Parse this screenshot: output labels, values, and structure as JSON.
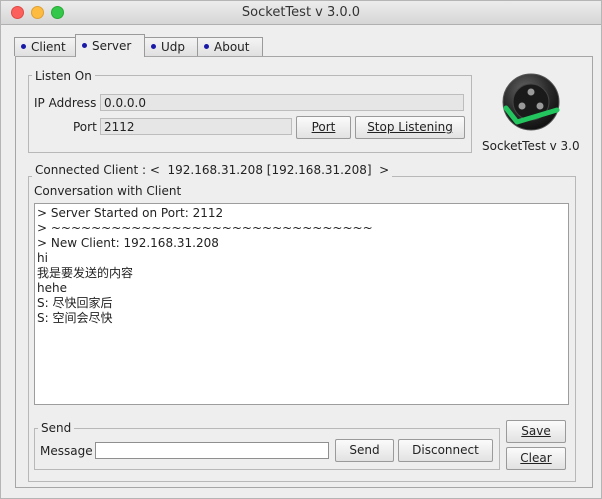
{
  "window": {
    "title": "SocketTest v 3.0.0"
  },
  "tabs": [
    {
      "label": "Client"
    },
    {
      "label": "Server",
      "active": true
    },
    {
      "label": "Udp"
    },
    {
      "label": "About"
    }
  ],
  "listen": {
    "group_label": "Listen On",
    "ip_label": "IP Address",
    "ip_value": "0.0.0.0",
    "port_label": "Port",
    "port_value": "2112",
    "port_button_label": "Port",
    "stop_button_label": "Stop Listening"
  },
  "logo": {
    "caption": "SocketTest v 3.0",
    "icon": "socket-logo-icon",
    "check_color": "#22c55e"
  },
  "connected": {
    "label": "Connected Client : <  192.168.31.208 [192.168.31.208]  >",
    "conversation_label": "Conversation with Client",
    "lines": [
      "> Server Started on Port: 2112",
      "> ~~~~~~~~~~~~~~~~~~~~~~~~~~~~~~~~",
      "> New Client: 192.168.31.208",
      "hi",
      "我是要发送的内容",
      "hehe",
      "S: 尽快回家后",
      "S: 空间会尽快"
    ]
  },
  "send": {
    "group_label": "Send",
    "message_label": "Message",
    "message_value": "",
    "send_button_label": "Send",
    "disconnect_button_label": "Disconnect"
  },
  "side_buttons": {
    "save_label": "Save",
    "clear_label": "Clear"
  }
}
